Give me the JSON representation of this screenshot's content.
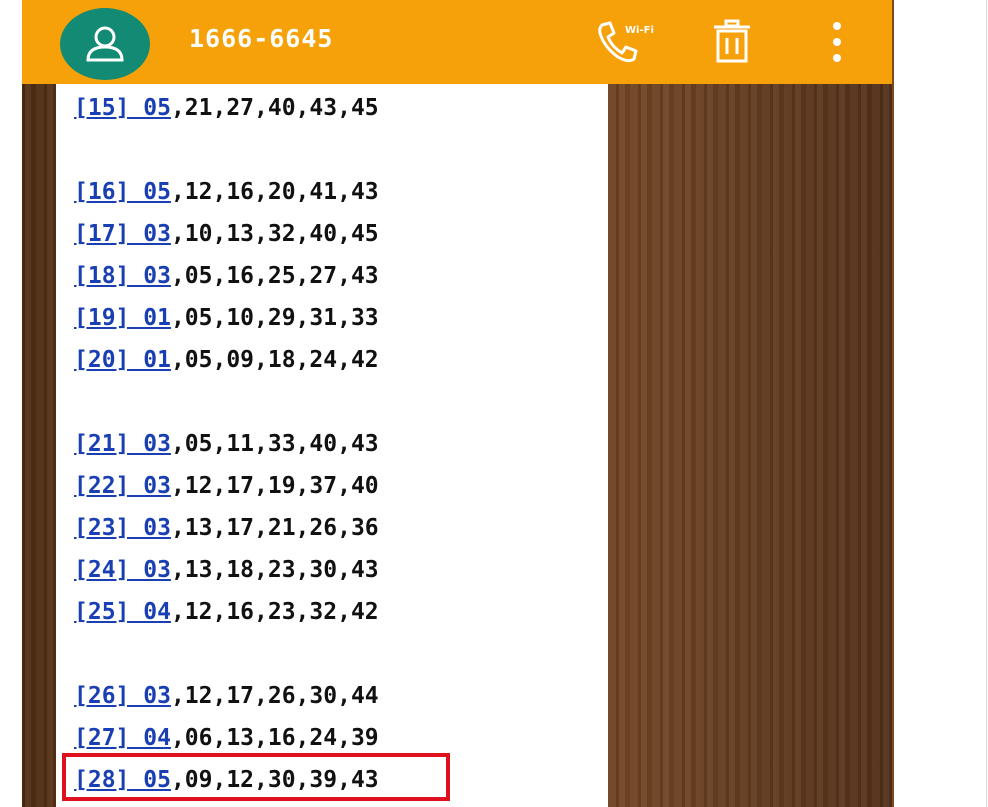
{
  "header": {
    "title": "1666-6645",
    "call_badge": "Wi-Fi"
  },
  "list": [
    {
      "num": "[15] 05",
      "rest": ",21,27,40,43,45"
    },
    {
      "num": "[16] 05",
      "rest": ",12,16,20,41,43"
    },
    {
      "num": "[17] 03",
      "rest": ",10,13,32,40,45"
    },
    {
      "num": "[18] 03",
      "rest": ",05,16,25,27,43"
    },
    {
      "num": "[19] 01",
      "rest": ",05,10,29,31,33"
    },
    {
      "num": "[20] 01",
      "rest": ",05,09,18,24,42"
    },
    {
      "num": "[21] 03",
      "rest": ",05,11,33,40,43"
    },
    {
      "num": "[22] 03",
      "rest": ",12,17,19,37,40"
    },
    {
      "num": "[23] 03",
      "rest": ",13,17,21,26,36"
    },
    {
      "num": "[24] 03",
      "rest": ",13,18,23,30,43"
    },
    {
      "num": "[25] 04",
      "rest": ",12,16,23,32,42"
    },
    {
      "num": "[26] 03",
      "rest": ",12,17,26,30,44"
    },
    {
      "num": "[27] 04",
      "rest": ",06,13,16,24,39"
    },
    {
      "num": "[28] 05",
      "rest": ",09,12,30,39,43"
    }
  ],
  "colors": {
    "appbar": "#f6a10a",
    "avatar": "#128a74",
    "link": "#1a3fb3",
    "highlight": "#e0101e"
  },
  "icons": {
    "avatar": "person-icon",
    "call": "wifi-call-icon",
    "delete": "trash-icon",
    "more": "more-vert-icon"
  }
}
